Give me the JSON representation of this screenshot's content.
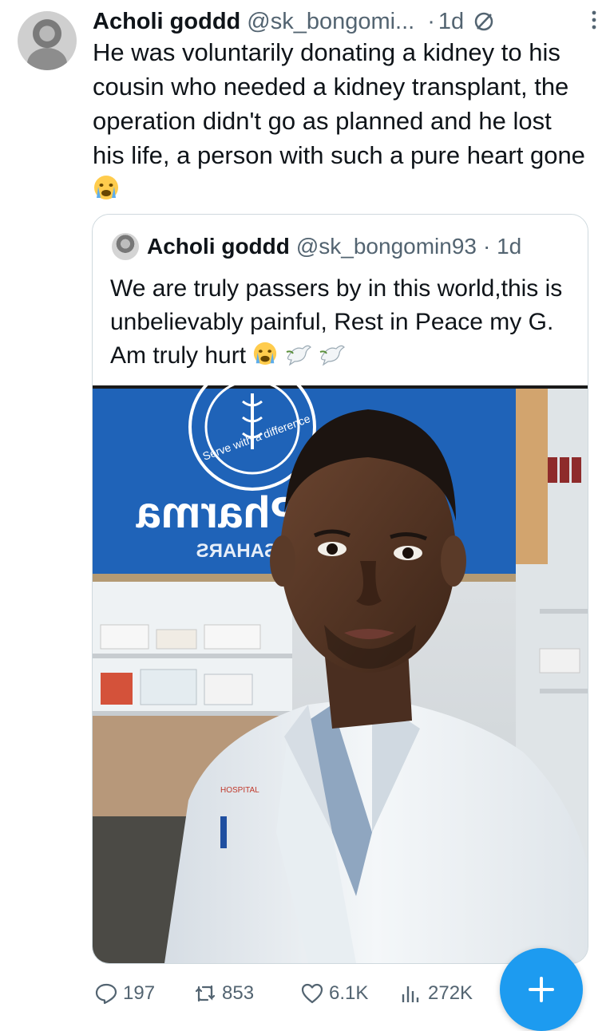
{
  "tweet": {
    "author_name": "Acholi goddd",
    "author_handle": "@sk_bongomi...",
    "dot": "·",
    "time": "1d",
    "text": "He was voluntarily donating a kidney to his cousin who needed a kidney transplant, the operation didn't go as planned and he lost his life, a person with such a pure heart gone"
  },
  "quoted_tweet": {
    "author_name": "Acholi goddd",
    "author_handle": "@sk_bongomin93",
    "time": "· 1d",
    "text": "We are truly passers by in this world,this is unbelievably painful, Rest in Peace my G. Am truly hurt",
    "image": {
      "sign_text_1": "Pharma",
      "sign_text_2": "N SAHARS",
      "sign_ring_text": "Serve with a difference"
    }
  },
  "actions": {
    "replies": "197",
    "reposts": "853",
    "likes": "6.1K",
    "views": "272K"
  },
  "icons": {
    "reply": "reply-icon",
    "repost": "repost-icon",
    "like": "heart-icon",
    "views": "views-icon",
    "compose": "plus-icon",
    "muted": "mute-icon",
    "more": "more-vertical-icon"
  },
  "colors": {
    "accent": "#1d9bf0",
    "text": "#0f1419",
    "secondary": "#536471",
    "border": "#cfd9de"
  }
}
